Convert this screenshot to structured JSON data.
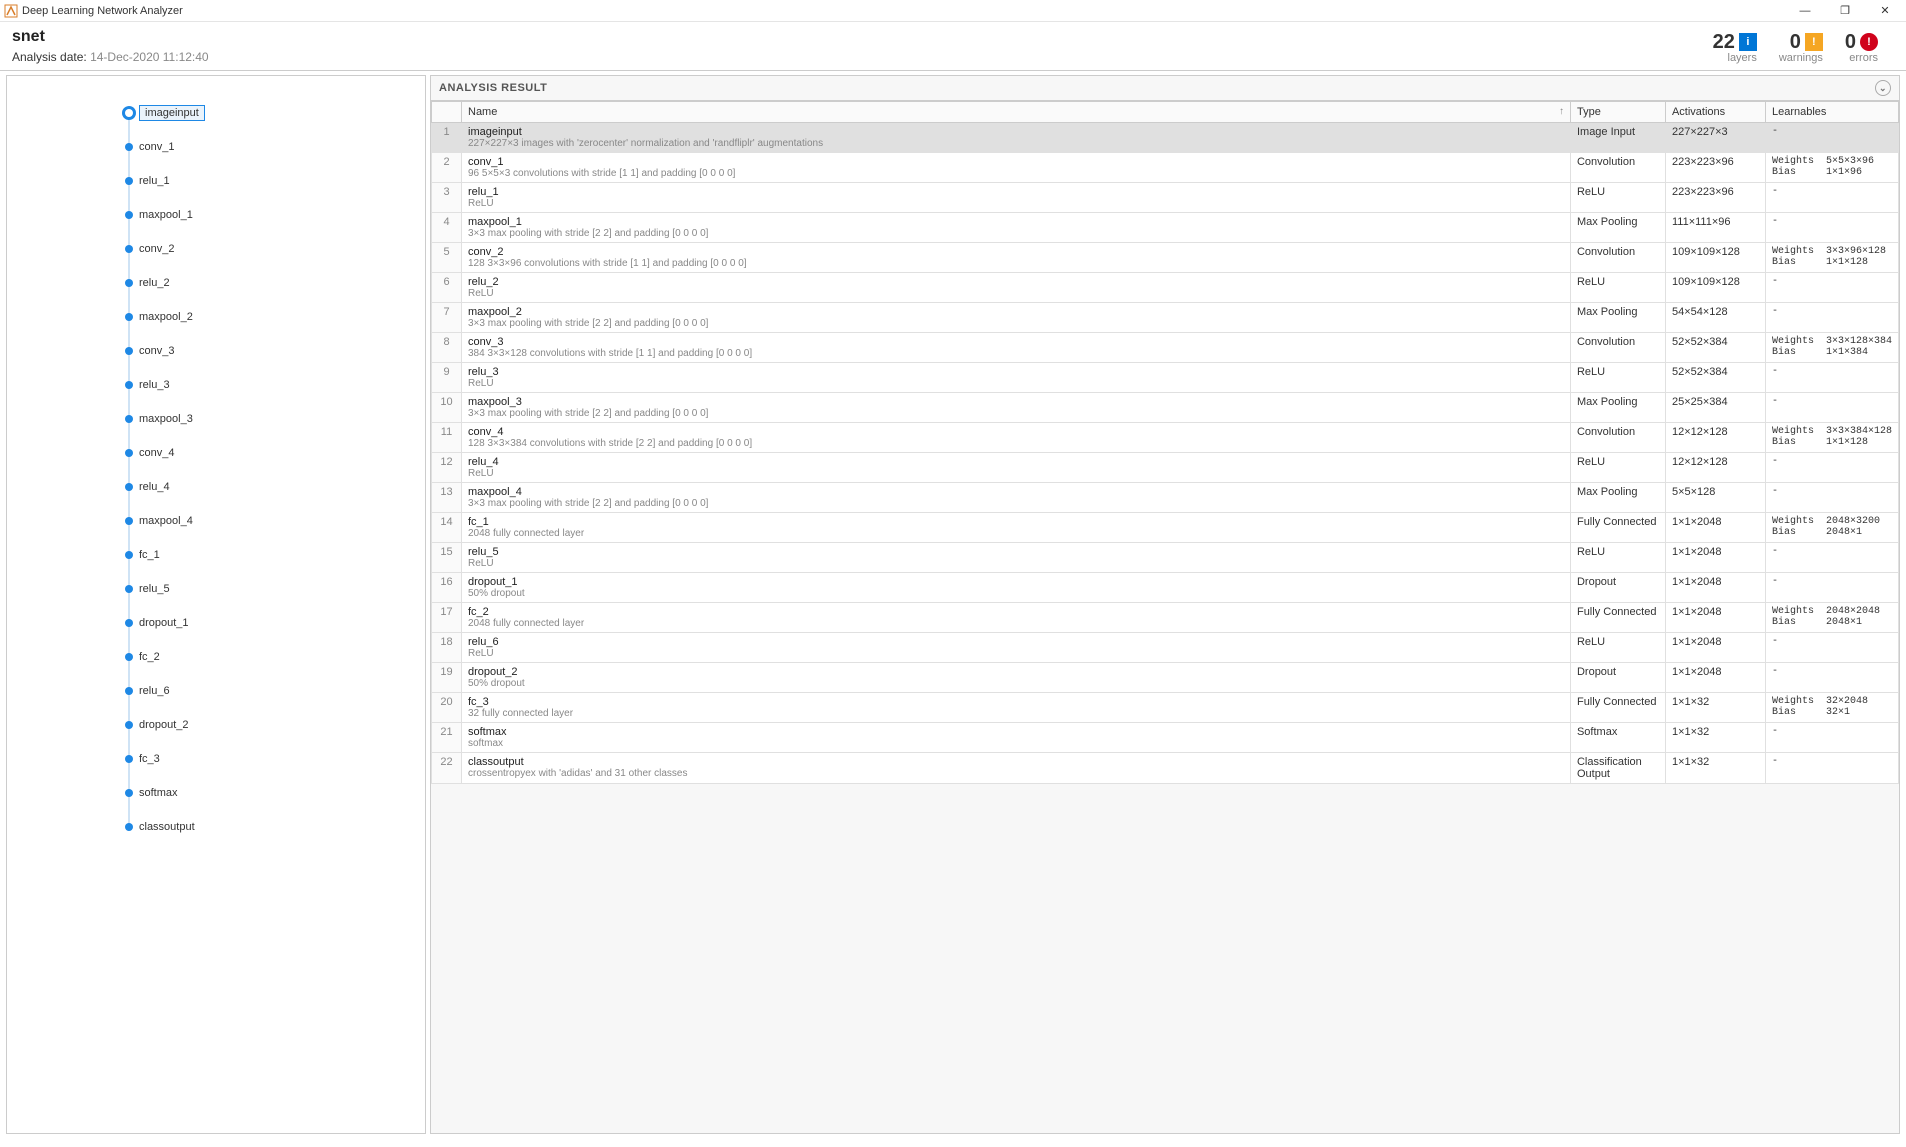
{
  "window": {
    "title": "Deep Learning Network Analyzer",
    "minimize": "—",
    "maximize": "❐",
    "close": "✕"
  },
  "header": {
    "net_name": "snet",
    "date_label": "Analysis date:",
    "date_value": "14-Dec-2020 11:12:40"
  },
  "stats": {
    "layers_num": "22",
    "layers_label": "layers",
    "warn_num": "0",
    "warn_label": "warnings",
    "err_num": "0",
    "err_label": "errors",
    "info_badge": "i",
    "warn_badge": "!",
    "err_badge": "!"
  },
  "result": {
    "title": "ANALYSIS RESULT",
    "columns": {
      "idx": "",
      "name": "Name",
      "type": "Type",
      "act": "Activations",
      "learn": "Learnables"
    }
  },
  "graph": [
    {
      "name": "imageinput",
      "selected": true
    },
    {
      "name": "conv_1"
    },
    {
      "name": "relu_1"
    },
    {
      "name": "maxpool_1"
    },
    {
      "name": "conv_2"
    },
    {
      "name": "relu_2"
    },
    {
      "name": "maxpool_2"
    },
    {
      "name": "conv_3"
    },
    {
      "name": "relu_3"
    },
    {
      "name": "maxpool_3"
    },
    {
      "name": "conv_4"
    },
    {
      "name": "relu_4"
    },
    {
      "name": "maxpool_4"
    },
    {
      "name": "fc_1"
    },
    {
      "name": "relu_5"
    },
    {
      "name": "dropout_1"
    },
    {
      "name": "fc_2"
    },
    {
      "name": "relu_6"
    },
    {
      "name": "dropout_2"
    },
    {
      "name": "fc_3"
    },
    {
      "name": "softmax"
    },
    {
      "name": "classoutput"
    }
  ],
  "rows": [
    {
      "idx": "1",
      "name": "imageinput",
      "desc": "227×227×3 images with 'zerocenter' normalization and 'randfliplr' augmentations",
      "type": "Image Input",
      "act": "227×227×3",
      "learn": "-",
      "sel": true
    },
    {
      "idx": "2",
      "name": "conv_1",
      "desc": "96 5×5×3 convolutions with stride [1 1] and padding [0 0 0 0]",
      "type": "Convolution",
      "act": "223×223×96",
      "learn": "Weights  5×5×3×96\nBias     1×1×96"
    },
    {
      "idx": "3",
      "name": "relu_1",
      "desc": "ReLU",
      "type": "ReLU",
      "act": "223×223×96",
      "learn": "-"
    },
    {
      "idx": "4",
      "name": "maxpool_1",
      "desc": "3×3 max pooling with stride [2 2] and padding [0 0 0 0]",
      "type": "Max Pooling",
      "act": "111×111×96",
      "learn": "-"
    },
    {
      "idx": "5",
      "name": "conv_2",
      "desc": "128 3×3×96 convolutions with stride [1 1] and padding [0 0 0 0]",
      "type": "Convolution",
      "act": "109×109×128",
      "learn": "Weights  3×3×96×128\nBias     1×1×128"
    },
    {
      "idx": "6",
      "name": "relu_2",
      "desc": "ReLU",
      "type": "ReLU",
      "act": "109×109×128",
      "learn": "-"
    },
    {
      "idx": "7",
      "name": "maxpool_2",
      "desc": "3×3 max pooling with stride [2 2] and padding [0 0 0 0]",
      "type": "Max Pooling",
      "act": "54×54×128",
      "learn": "-"
    },
    {
      "idx": "8",
      "name": "conv_3",
      "desc": "384 3×3×128 convolutions with stride [1 1] and padding [0 0 0 0]",
      "type": "Convolution",
      "act": "52×52×384",
      "learn": "Weights  3×3×128×384\nBias     1×1×384"
    },
    {
      "idx": "9",
      "name": "relu_3",
      "desc": "ReLU",
      "type": "ReLU",
      "act": "52×52×384",
      "learn": "-"
    },
    {
      "idx": "10",
      "name": "maxpool_3",
      "desc": "3×3 max pooling with stride [2 2] and padding [0 0 0 0]",
      "type": "Max Pooling",
      "act": "25×25×384",
      "learn": "-"
    },
    {
      "idx": "11",
      "name": "conv_4",
      "desc": "128 3×3×384 convolutions with stride [2 2] and padding [0 0 0 0]",
      "type": "Convolution",
      "act": "12×12×128",
      "learn": "Weights  3×3×384×128\nBias     1×1×128"
    },
    {
      "idx": "12",
      "name": "relu_4",
      "desc": "ReLU",
      "type": "ReLU",
      "act": "12×12×128",
      "learn": "-"
    },
    {
      "idx": "13",
      "name": "maxpool_4",
      "desc": "3×3 max pooling with stride [2 2] and padding [0 0 0 0]",
      "type": "Max Pooling",
      "act": "5×5×128",
      "learn": "-"
    },
    {
      "idx": "14",
      "name": "fc_1",
      "desc": "2048 fully connected layer",
      "type": "Fully Connected",
      "act": "1×1×2048",
      "learn": "Weights  2048×3200\nBias     2048×1"
    },
    {
      "idx": "15",
      "name": "relu_5",
      "desc": "ReLU",
      "type": "ReLU",
      "act": "1×1×2048",
      "learn": "-"
    },
    {
      "idx": "16",
      "name": "dropout_1",
      "desc": "50% dropout",
      "type": "Dropout",
      "act": "1×1×2048",
      "learn": "-"
    },
    {
      "idx": "17",
      "name": "fc_2",
      "desc": "2048 fully connected layer",
      "type": "Fully Connected",
      "act": "1×1×2048",
      "learn": "Weights  2048×2048\nBias     2048×1"
    },
    {
      "idx": "18",
      "name": "relu_6",
      "desc": "ReLU",
      "type": "ReLU",
      "act": "1×1×2048",
      "learn": "-"
    },
    {
      "idx": "19",
      "name": "dropout_2",
      "desc": "50% dropout",
      "type": "Dropout",
      "act": "1×1×2048",
      "learn": "-"
    },
    {
      "idx": "20",
      "name": "fc_3",
      "desc": "32 fully connected layer",
      "type": "Fully Connected",
      "act": "1×1×32",
      "learn": "Weights  32×2048\nBias     32×1"
    },
    {
      "idx": "21",
      "name": "softmax",
      "desc": "softmax",
      "type": "Softmax",
      "act": "1×1×32",
      "learn": "-"
    },
    {
      "idx": "22",
      "name": "classoutput",
      "desc": "crossentropyex with 'adidas' and 31 other classes",
      "type": "Classification Output",
      "act": "1×1×32",
      "learn": "-"
    }
  ]
}
